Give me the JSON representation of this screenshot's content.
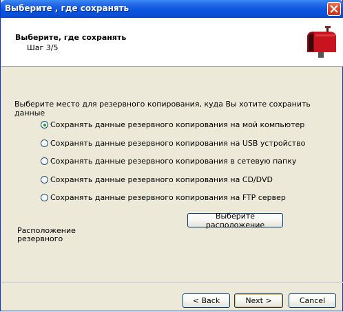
{
  "window": {
    "title": "Выберите , где сохранять"
  },
  "header": {
    "title": "Выберите, где сохранять",
    "step": "Шаг 3/5",
    "icon": "mailbox-icon"
  },
  "prompt": "Выберите место для резервного копирования, куда Вы хотите сохранить данные",
  "options": [
    {
      "label": "Сохранять данные резервного копирования на мой компьютер",
      "checked": true
    },
    {
      "label": "Сохранять данные резервного копирования на USB устройство",
      "checked": false
    },
    {
      "label": "Сохранять данные резервного копирования в сетевую папку",
      "checked": false
    },
    {
      "label": "Сохранять данные резервного копирования на CD/DVD",
      "checked": false
    },
    {
      "label": "Сохранять данные резервного копирования на FTP сервер",
      "checked": false
    }
  ],
  "choose_location_button": "Выберите расположение",
  "location_label": "Расположение резервного",
  "location_label_lines": [
    "Расположение",
    "резервного"
  ],
  "buttons": {
    "back": "< Back",
    "next": "Next >",
    "cancel": "Cancel"
  }
}
